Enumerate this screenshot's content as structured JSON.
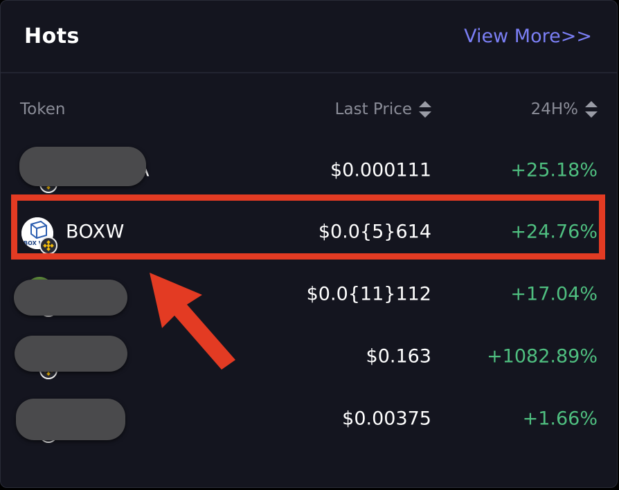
{
  "header": {
    "title": "Hots",
    "view_more": "View More>>"
  },
  "columns": {
    "token": "Token",
    "last_price": "Last Price",
    "change_24h": "24H%"
  },
  "rows": [
    {
      "name": "",
      "name_suffix": "A",
      "price": "$0.000111",
      "change": "+25.18%",
      "redacted": true
    },
    {
      "name": "BOXW",
      "price": "$0.0{5}614",
      "change": "+24.76%",
      "redacted": false,
      "icon_text": "BOX W"
    },
    {
      "name": "",
      "price": "$0.0{11}112",
      "change": "+17.04%",
      "redacted": true
    },
    {
      "name": "",
      "price": "$0.163",
      "change": "+1082.89%",
      "redacted": true
    },
    {
      "name": "",
      "price": "$0.00375",
      "change": "+1.66%",
      "redacted": true
    }
  ],
  "colors": {
    "background": "#14151f",
    "accent": "#7b7ff5",
    "positive": "#4fbf80",
    "highlight": "#e33b23",
    "chain": "#f0b90b"
  },
  "icons": {
    "chain": "bnb-chain-icon",
    "sort": "sort-icon"
  }
}
